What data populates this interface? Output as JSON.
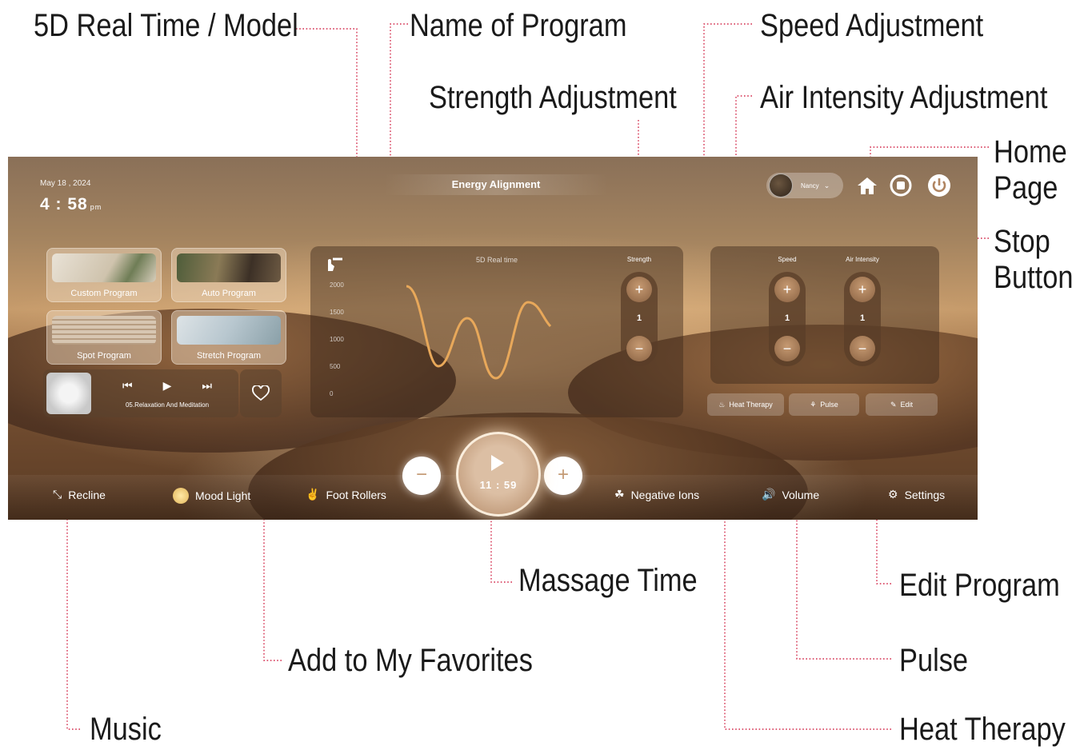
{
  "callouts": {
    "model": "5D Real Time / Model",
    "program_name": "Name of Program",
    "speed": "Speed Adjustment",
    "strength": "Strength Adjustment",
    "air": "Air Intensity Adjustment",
    "home": [
      "Home",
      "Page"
    ],
    "stop": [
      "Stop",
      "Button"
    ],
    "massage_time": "Massage Time",
    "edit_program": "Edit Program",
    "favorites": "Add to My Favorites",
    "pulse": "Pulse",
    "music": "Music",
    "heat_therapy": "Heat Therapy"
  },
  "screen": {
    "date": "May 18 , 2024",
    "time": "4 : 58",
    "ampm": "pm",
    "program_name": "Energy Alignment",
    "user": "Nancy",
    "tiles": [
      "Custom Program",
      "Auto Program",
      "Spot Program",
      "Stretch Program"
    ],
    "music_track": "05.Relaxation And Meditation",
    "chart": {
      "title": "5D Real time",
      "yticks": [
        "2000",
        "1500",
        "1000",
        "500",
        "0"
      ]
    },
    "strength": {
      "label": "Strength",
      "value": "1"
    },
    "speed": {
      "label": "Speed",
      "value": "1"
    },
    "air": {
      "label": "Air Intensity",
      "value": "1"
    },
    "mini_buttons": {
      "heat": "Heat Therapy",
      "pulse": "Pulse",
      "edit": "Edit"
    },
    "timer": "11 : 59",
    "bottom_bar": [
      "Recline",
      "Mood Light",
      "Foot Rollers",
      "Negative Ions",
      "Volume",
      "Settings"
    ]
  },
  "colors": {
    "leader": "#d32a4b",
    "accent_wave": "#e8a85a"
  }
}
